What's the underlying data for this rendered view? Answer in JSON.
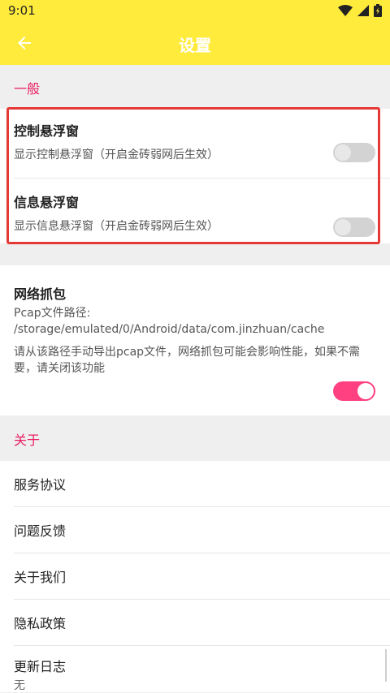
{
  "status_bar": {
    "time": "9:01",
    "icons": [
      "wifi-icon",
      "signal-icon",
      "battery-icon"
    ]
  },
  "app_bar": {
    "title": "设置",
    "back_icon": "back-arrow-icon",
    "bg_color": "#ffeb3b"
  },
  "sections": {
    "general": {
      "header": "一般",
      "items": [
        {
          "title": "控制悬浮窗",
          "subtitle": "显示控制悬浮窗（开启金砖弱网后生效）",
          "enabled": false
        },
        {
          "title": "信息悬浮窗",
          "subtitle": "显示信息悬浮窗（开启金砖弱网后生效）",
          "enabled": false
        }
      ]
    },
    "network_capture": {
      "title": "网络抓包",
      "path": "Pcap文件路径: /storage/emulated/0/Android/data/com.jinzhuan/cache",
      "description": "请从该路径手动导出pcap文件，网络抓包可能会影响性能，如果不需要，请关闭该功能",
      "enabled": true
    },
    "about": {
      "header": "关于",
      "items": [
        {
          "label": "服务协议"
        },
        {
          "label": "问题反馈"
        },
        {
          "label": "关于我们"
        },
        {
          "label": "隐私政策"
        },
        {
          "label": "更新日志",
          "subtitle": "无"
        }
      ]
    }
  },
  "colors": {
    "accent": "#e91e63",
    "switch_on": "#ff4081",
    "highlight_border": "#e53935"
  }
}
